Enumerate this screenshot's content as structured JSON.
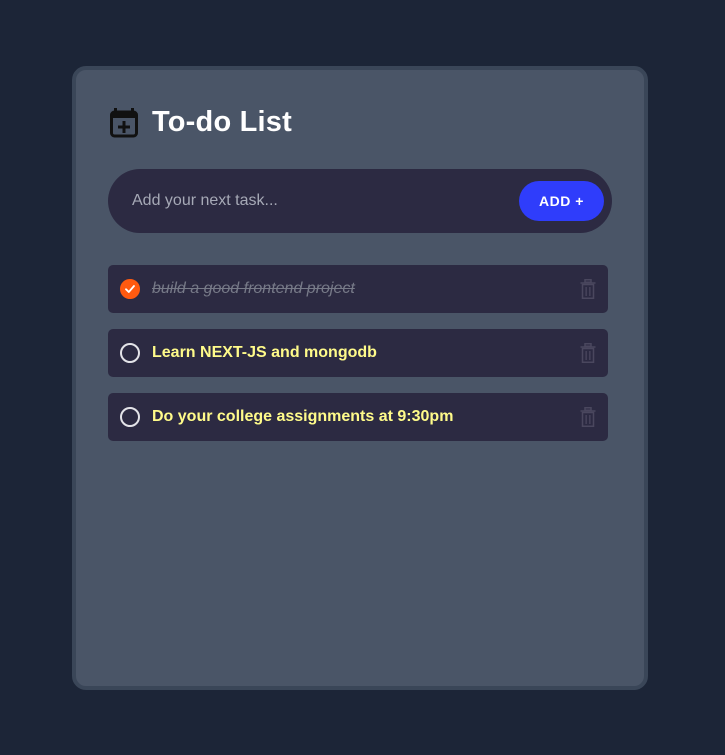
{
  "header": {
    "title": "To-do List",
    "icon": "calendar-plus-icon"
  },
  "input": {
    "placeholder": "Add your next task...",
    "value": "",
    "add_label": "ADD +"
  },
  "tasks": [
    {
      "text": "build a good frontend project",
      "done": true
    },
    {
      "text": "Learn NEXT-JS and mongodb",
      "done": false
    },
    {
      "text": "Do your college assignments at 9:30pm",
      "done": false
    }
  ],
  "colors": {
    "background": "#1c2537",
    "card": "#4a5567",
    "row": "#2c2a42",
    "accent_button": "#2f3dfb",
    "check_done": "#ff5a10",
    "task_text": "#fffb8a",
    "done_text": "#777a88"
  },
  "icons": {
    "check": "check-circle-icon",
    "unchecked": "circle-icon",
    "delete": "trash-icon"
  }
}
